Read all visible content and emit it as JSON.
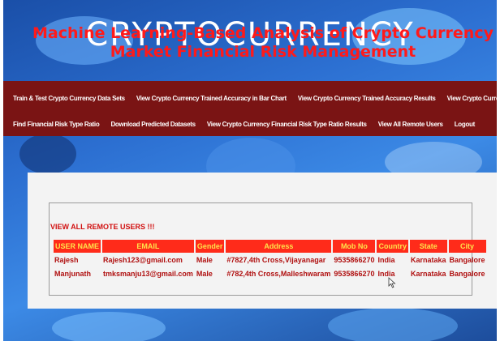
{
  "app": {
    "title": "Machine Learning-Based Analysis of Crypto Currency Market Financial Risk Management",
    "banner_word": "CRYPTOCURRENCY"
  },
  "nav": {
    "row1": [
      "Train & Test Crypto Currency Data Sets",
      "View Crypto Currency Trained Accuracy in Bar Chart",
      "View Crypto Currency Trained Accuracy Results",
      "View Crypto Currency Financial Risk Type"
    ],
    "row2": [
      "Find Financial Risk Type Ratio",
      "Download Predicted Datasets",
      "View Crypto Currency Financial Risk Type Ratio Results",
      "View All Remote Users",
      "Logout"
    ]
  },
  "remote_users": {
    "heading": "VIEW ALL REMOTE USERS !!!",
    "columns": [
      "USER NAME",
      "EMAIL",
      "Gender",
      "Address",
      "Mob No",
      "Country",
      "State",
      "City"
    ],
    "rows": [
      [
        "Rajesh",
        "Rajesh123@gmail.com",
        "Male",
        "#7827,4th Cross,Vijayanagar",
        "9535866270",
        "India",
        "Karnataka",
        "Bangalore"
      ],
      [
        "Manjunath",
        "tmksmanju13@gmail.com",
        "Male",
        "#782,4th Cross,Malleshwaram",
        "9535866270",
        "India",
        "Karnataka",
        "Bangalore"
      ]
    ]
  },
  "colors": {
    "nav_bg": "#7a1414",
    "title_red": "#ff1a1a",
    "header_bg": "#ff2b1a",
    "header_text": "#ffe24a",
    "cell_text": "#b01010"
  }
}
